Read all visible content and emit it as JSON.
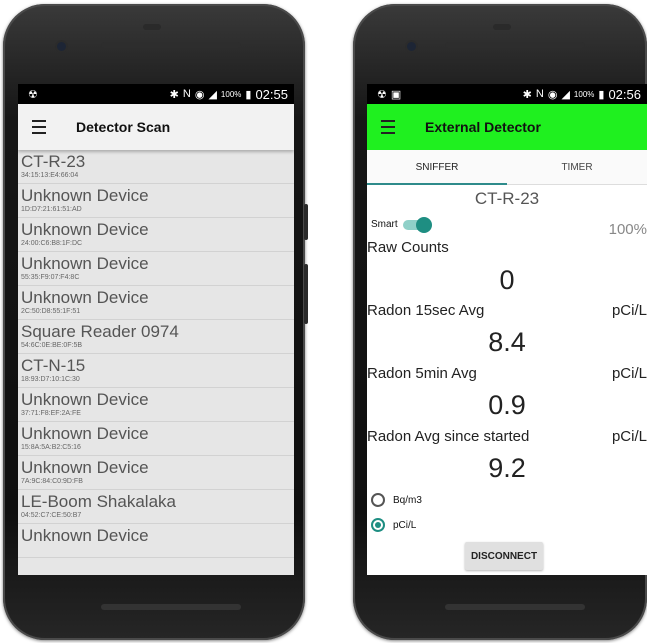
{
  "left_phone": {
    "status": {
      "left_icon": "☢",
      "bt": "✱",
      "nfc": "N",
      "wifi": "◉",
      "signal": "◢",
      "battery_pct": "100%",
      "battery_icon": "▮",
      "time": "02:55"
    },
    "appbar": {
      "title": "Detector Scan"
    },
    "devices": [
      {
        "name": "CT-R-23",
        "mac": "34:15:13:E4:66:04"
      },
      {
        "name": "Unknown Device",
        "mac": "1D:D7:21:61:51:AD"
      },
      {
        "name": "Unknown Device",
        "mac": "24:00:C6:B8:1F:DC"
      },
      {
        "name": "Unknown Device",
        "mac": "55:35:F9:07:F4:8C"
      },
      {
        "name": "Unknown Device",
        "mac": "2C:50:D8:55:1F:51"
      },
      {
        "name": "Square Reader 0974",
        "mac": "54:6C:0E:BE:0F:5B"
      },
      {
        "name": "CT-N-15",
        "mac": "18:93:D7:10:1C:30"
      },
      {
        "name": "Unknown Device",
        "mac": "37:71:F8:EF:2A:FE"
      },
      {
        "name": "Unknown Device",
        "mac": "15:8A:5A:B2:C5:16"
      },
      {
        "name": "Unknown Device",
        "mac": "7A:9C:84:C0:9D:FB"
      },
      {
        "name": "LE-Boom Shakalaka",
        "mac": "04:52:C7:CE:50:B7"
      },
      {
        "name": "Unknown Device",
        "mac": ""
      }
    ]
  },
  "right_phone": {
    "status": {
      "left_icon": "☢",
      "left_icon2": "▣",
      "bt": "✱",
      "nfc": "N",
      "wifi": "◉",
      "signal": "◢",
      "battery_pct": "100%",
      "battery_icon": "▮",
      "time": "02:56"
    },
    "appbar": {
      "title": "External Detector",
      "color": "#1ff01f"
    },
    "tabs": {
      "sniffer": "SNIFFER",
      "timer": "TIMER"
    },
    "device_name": "CT-R-23",
    "smart_label": "Smart",
    "smart_on": true,
    "battery_level": "100%",
    "raw_counts_label": "Raw Counts",
    "raw_counts_value": "0",
    "radon_15sec_label": "Radon 15sec Avg",
    "radon_15sec_unit": "pCi/L",
    "radon_15sec_value": "8.4",
    "radon_5min_label": "Radon 5min Avg",
    "radon_5min_unit": "pCi/L",
    "radon_5min_value": "0.9",
    "radon_avg_label": "Radon Avg since started",
    "radon_avg_unit": "pCi/L",
    "radon_avg_value": "9.2",
    "unit_options": [
      {
        "label": "Bq/m3",
        "selected": false
      },
      {
        "label": "pCi/L",
        "selected": true
      }
    ],
    "disconnect_label": "DISCONNECT"
  }
}
